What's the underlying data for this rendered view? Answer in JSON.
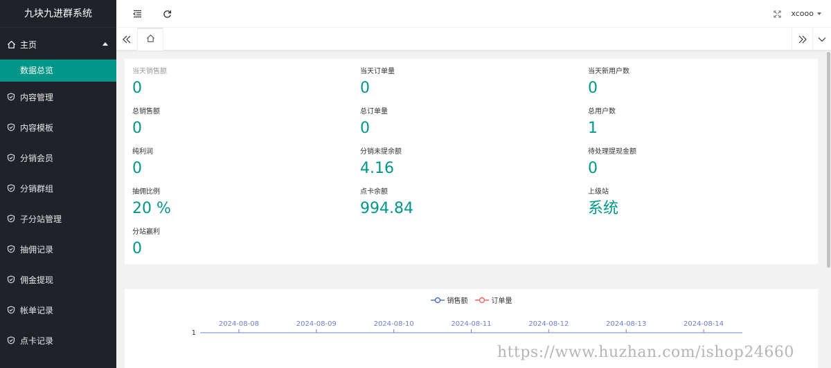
{
  "sidebar": {
    "brand": "九块九进群系统",
    "home": {
      "label": "主页",
      "icon": "home-icon"
    },
    "home_sub": {
      "label": "数据总览"
    },
    "items": [
      {
        "label": "内容管理",
        "icon": "shield-icon"
      },
      {
        "label": "内容模板",
        "icon": "shield-icon"
      },
      {
        "label": "分销会员",
        "icon": "shield-icon"
      },
      {
        "label": "分销群组",
        "icon": "shield-icon"
      },
      {
        "label": "子分站管理",
        "icon": "shield-icon"
      },
      {
        "label": "抽佣记录",
        "icon": "shield-icon"
      },
      {
        "label": "佣金提现",
        "icon": "shield-icon"
      },
      {
        "label": "帐单记录",
        "icon": "shield-icon"
      },
      {
        "label": "点卡记录",
        "icon": "shield-icon"
      }
    ]
  },
  "header": {
    "user": "xcooo",
    "icons": [
      "indent-icon",
      "refresh-icon",
      "fullscreen-icon"
    ]
  },
  "tabs": {
    "home_icon": "home-icon",
    "left_icon": "double-chevron-left-icon",
    "right_icon": "double-chevron-right-icon",
    "menu_icon": "chevron-down-icon"
  },
  "stats": [
    {
      "label": "当天销售额",
      "value": "0"
    },
    {
      "label": "当天订单量",
      "value": "0"
    },
    {
      "label": "当天新用户数",
      "value": "0"
    },
    {
      "label": "总销售额",
      "value": "0"
    },
    {
      "label": "总订单量",
      "value": "0"
    },
    {
      "label": "总用户数",
      "value": "1"
    },
    {
      "label": "纯利润",
      "value": "0"
    },
    {
      "label": "分销未提余额",
      "value": "4.16"
    },
    {
      "label": "待处理提现金额",
      "value": "0"
    },
    {
      "label": "抽佣比例",
      "value": "20 %"
    },
    {
      "label": "点卡余额",
      "value": "994.84"
    },
    {
      "label": "上级站",
      "value": "系统"
    },
    {
      "label": "分站赢利",
      "value": "0"
    }
  ],
  "chart_data": {
    "type": "line",
    "x": [
      "2024-08-08",
      "2024-08-09",
      "2024-08-10",
      "2024-08-11",
      "2024-08-12",
      "2024-08-13",
      "2024-08-14"
    ],
    "series": [
      {
        "name": "销售额",
        "values": [
          null,
          null,
          null,
          null,
          null,
          null,
          null
        ],
        "color": "#5470c6"
      },
      {
        "name": "订单量",
        "values": [
          null,
          null,
          null,
          null,
          null,
          null,
          null
        ],
        "color": "#ee6666"
      }
    ],
    "y_ticks": [
      "1"
    ],
    "colors": {
      "axis": "#6e7fc9"
    }
  },
  "watermark": "https://www.huzhan.com/ishop24660",
  "colors": {
    "accent": "#009688",
    "sidebar_bg": "#20222a"
  }
}
